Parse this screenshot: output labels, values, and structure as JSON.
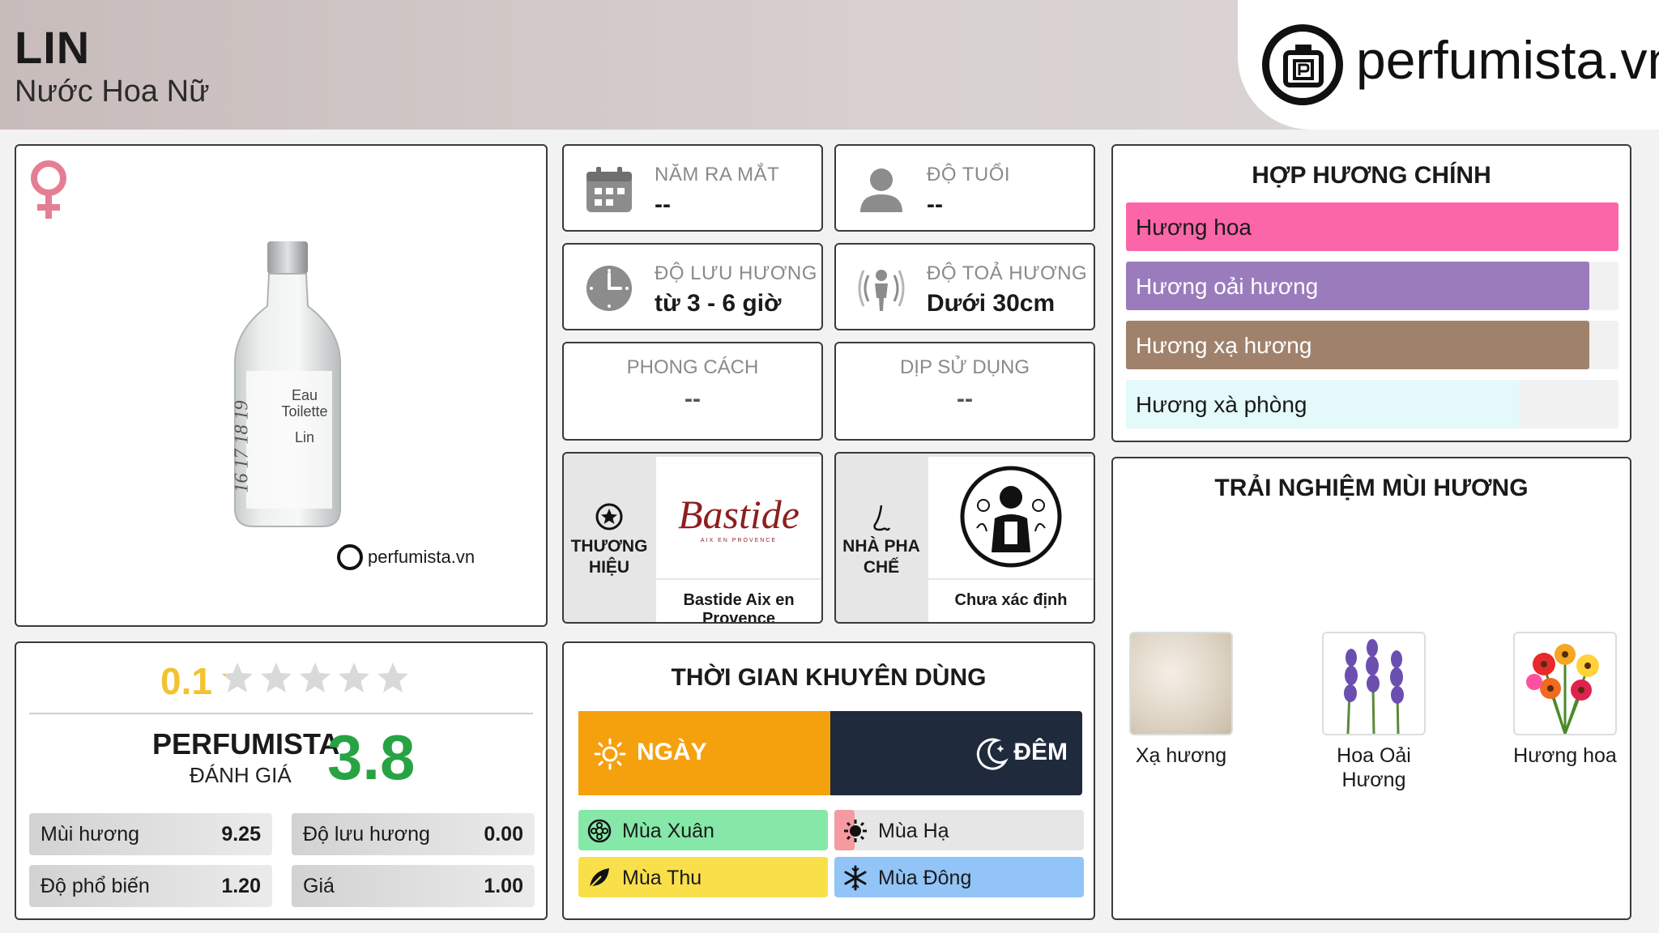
{
  "header": {
    "title": "LIN",
    "subtitle": "Nước Hoa Nữ",
    "logo_text": "perfumista.vn"
  },
  "product_image": {
    "gender_icon": "female-symbol-icon",
    "bottle_label_line1": "Eau",
    "bottle_label_line2": "Toilette",
    "bottle_label_line3": "Lin",
    "bottle_side_text": "16 17 18 19",
    "watermark_text": "perfumista.vn"
  },
  "info": {
    "year": {
      "label": "NĂM RA MẮT",
      "value": "--",
      "icon": "calendar-icon"
    },
    "age": {
      "label": "ĐỘ TUỔI",
      "value": "--",
      "icon": "person-icon"
    },
    "longevity": {
      "label": "ĐỘ LƯU HƯƠNG",
      "value": "từ 3 - 6 giờ",
      "icon": "clock-icon"
    },
    "sillage": {
      "label": "ĐỘ TOẢ HƯƠNG",
      "value": "Dưới 30cm",
      "icon": "sillage-icon"
    },
    "style": {
      "label": "PHONG CÁCH",
      "value": "--"
    },
    "occasion": {
      "label": "DỊP SỬ DỤNG",
      "value": "--"
    }
  },
  "brand": {
    "side_label_line1": "THƯƠNG",
    "side_label_line2": "HIỆU",
    "logo_text": "Bastide",
    "logo_sub": "AIX EN PROVENCE",
    "name": "Bastide Aix en Provence"
  },
  "perfumer": {
    "side_label_line1": "NHÀ PHA",
    "side_label_line2": "CHẾ",
    "name": "Chưa xác định"
  },
  "rating": {
    "user_score": "0.1",
    "user_stars": 0.1,
    "stars_max": 5,
    "perfumista_label": "PERFUMISTA",
    "perfumista_sub": "ĐÁNH GIÁ",
    "perfumista_score": "3.8",
    "metrics": [
      {
        "label": "Mùi hương",
        "value": "9.25"
      },
      {
        "label": "Độ lưu hương",
        "value": "0.00"
      },
      {
        "label": "Độ phổ biến",
        "value": "1.20"
      },
      {
        "label": "Giá",
        "value": "1.00"
      }
    ]
  },
  "time": {
    "title": "THỜI GIAN KHUYÊN DÙNG",
    "day_label": "NGÀY",
    "night_label": "ĐÊM",
    "day_fraction": 0.5,
    "seasons": [
      {
        "label": "Mùa Xuân",
        "color": "#86e8a8",
        "fraction": 1.0
      },
      {
        "label": "Mùa Hạ",
        "color": "#f59aa0",
        "fraction": 0.08
      },
      {
        "label": "Mùa Thu",
        "color": "#f9e04b",
        "fraction": 1.0
      },
      {
        "label": "Mùa Đông",
        "color": "#92c4f7",
        "fraction": 1.0
      }
    ]
  },
  "accords": {
    "title": "HỢP HƯƠNG CHÍNH",
    "items": [
      {
        "label": "Hương hoa",
        "color": "#fb66a8",
        "fraction": 1.0
      },
      {
        "label": "Hương oải hương",
        "color": "#9a7cbc",
        "fraction": 0.94
      },
      {
        "label": "Hương xạ hương",
        "color": "#a0826c",
        "fraction": 0.94
      },
      {
        "label": "Hương xà phòng",
        "color": "#e4f9f9",
        "fraction": 0.8
      }
    ]
  },
  "experience": {
    "title": "TRẢI NGHIỆM MÙI HƯƠNG",
    "items": [
      {
        "label": "Xạ hương",
        "icon": "musk-image"
      },
      {
        "label": "Hoa Oải Hương",
        "icon": "lavender-image"
      },
      {
        "label": "Hương hoa",
        "icon": "flowers-image"
      }
    ]
  }
}
